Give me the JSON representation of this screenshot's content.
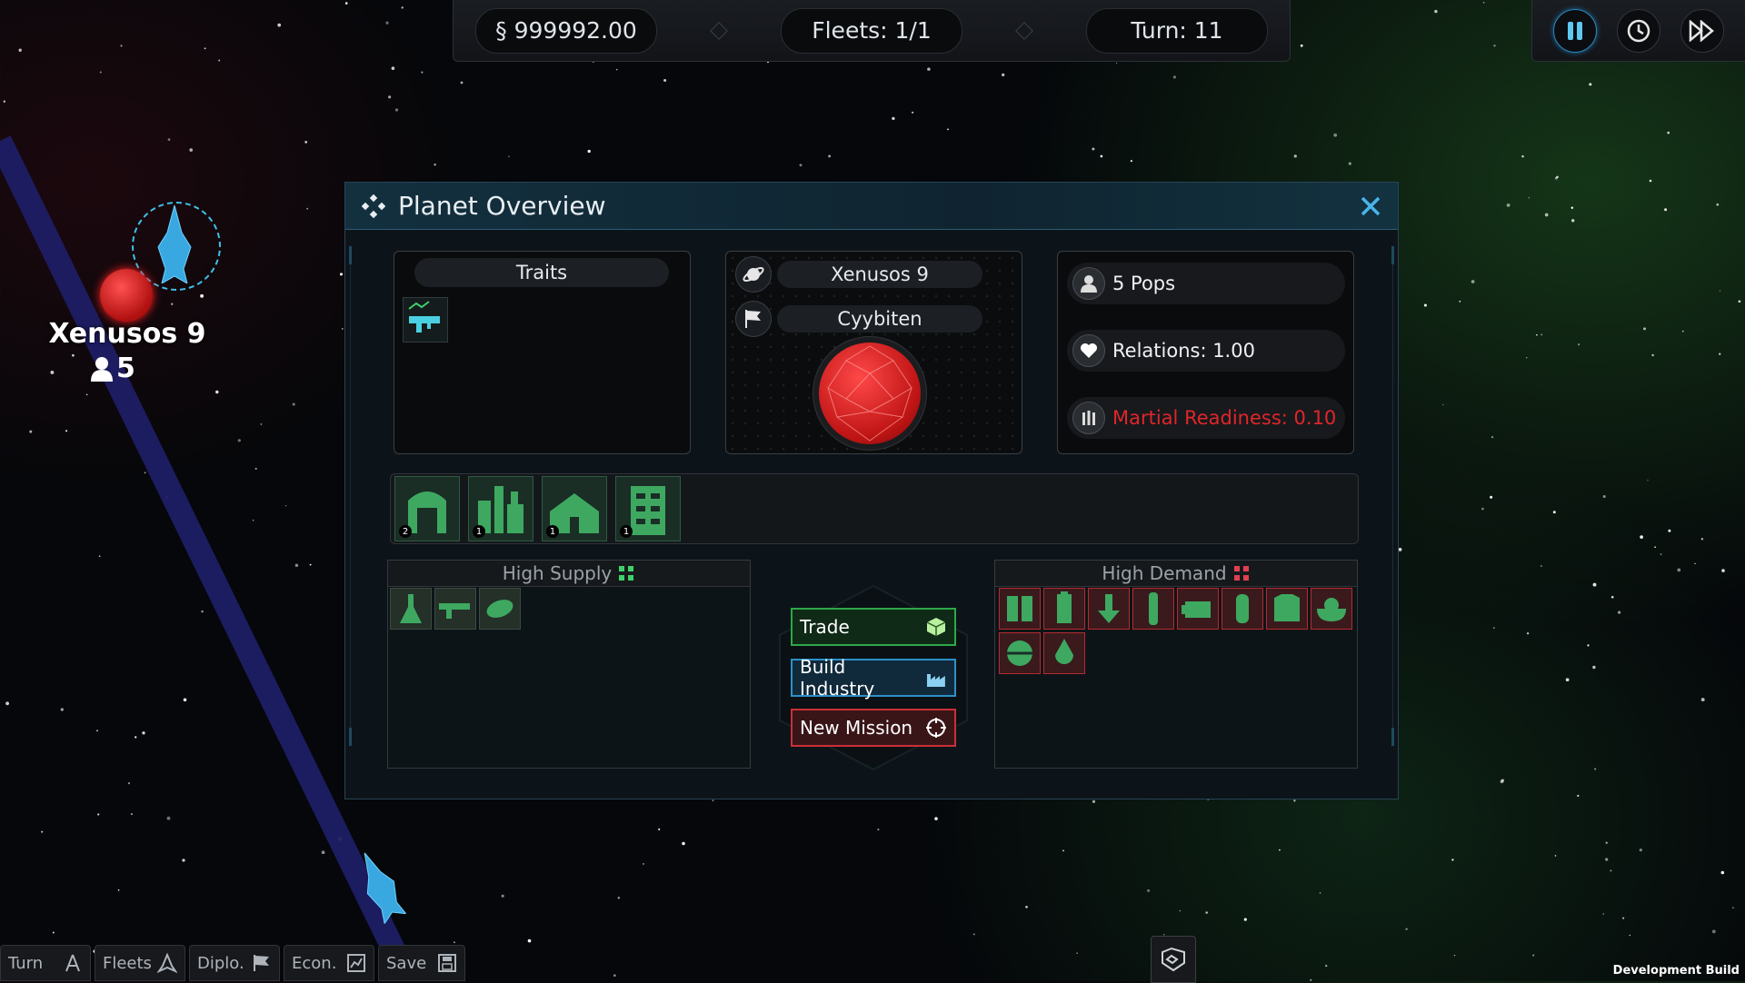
{
  "topbar": {
    "money": "§ 999992.00",
    "fleets": "Fleets: 1/1",
    "turn": "Turn: 11"
  },
  "controls": {
    "pause_icon": "pause-icon",
    "time_icon": "clock-icon",
    "fast_icon": "fast-forward-icon"
  },
  "map": {
    "planet_name": "Xenusos 9",
    "planet_pop": "5"
  },
  "modal": {
    "title": "Planet Overview",
    "traits_header": "Traits",
    "planet_name": "Xenusos 9",
    "faction": "Cyybiten",
    "pops": "5 Pops",
    "relations": "Relations: 1.00",
    "martial": "Martial Readiness: 0.10",
    "buildings": [
      {
        "count": "2",
        "icon": "arch-building-icon"
      },
      {
        "count": "1",
        "icon": "factory-building-icon"
      },
      {
        "count": "1",
        "icon": "house-building-icon"
      },
      {
        "count": "1",
        "icon": "tower-building-icon"
      }
    ],
    "supply_header": "High Supply",
    "demand_header": "High Demand",
    "supply_items": [
      "flask-icon",
      "rifle-icon",
      "ore-icon"
    ],
    "demand_items": [
      "panels-icon",
      "battery-icon",
      "arrow-down-icon",
      "capsule-icon",
      "engine-icon",
      "canister-icon",
      "armor-icon",
      "food-bowl-icon",
      "orb-icon",
      "droplet-icon"
    ],
    "trade_label": "Trade",
    "build_label": "Build Industry",
    "mission_label": "New Mission"
  },
  "bottombar": {
    "turn": "Turn",
    "fleets": "Fleets",
    "diplo": "Diplo.",
    "econ": "Econ.",
    "save": "Save"
  },
  "dev_build": "Development Build",
  "colors": {
    "accent_blue": "#2e90c8",
    "trade_green": "#2ea84a",
    "mission_red": "#c83038",
    "readiness_red": "#e0262a",
    "planet_red": "#e02020"
  }
}
